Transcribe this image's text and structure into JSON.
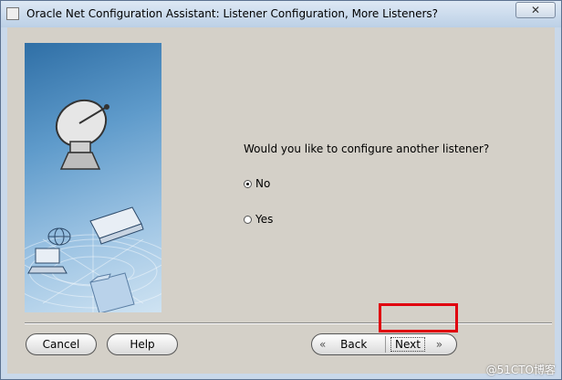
{
  "window": {
    "title": "Oracle Net Configuration Assistant: Listener Configuration, More Listeners?",
    "close_glyph": "✕"
  },
  "content": {
    "question": "Would you like to configure another listener?",
    "options": [
      {
        "label": "No",
        "selected": true
      },
      {
        "label": "Yes",
        "selected": false
      }
    ]
  },
  "buttons": {
    "cancel": "Cancel",
    "help": "Help",
    "back": "Back",
    "next": "Next"
  },
  "watermark": "@51CTO博客",
  "colors": {
    "highlight": "#e0000f",
    "dialog_bg": "#d4d0c8"
  }
}
